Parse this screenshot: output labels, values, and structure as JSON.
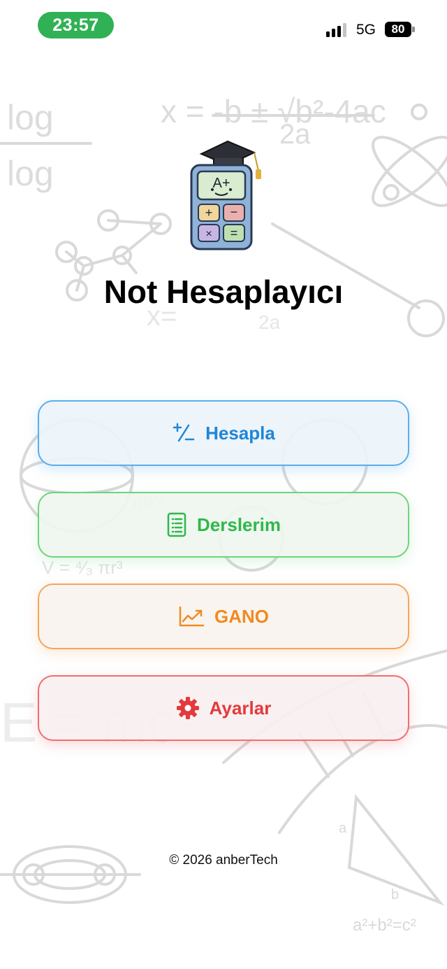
{
  "status_bar": {
    "time": "23:57",
    "network": "5G",
    "battery": "80"
  },
  "app": {
    "title": "Not Hesaplayıcı",
    "logo_text": "A+"
  },
  "menu": {
    "hesapla_label": "Hesapla",
    "derslerim_label": "Derslerim",
    "gano_label": "GANO",
    "ayarlar_label": "Ayarlar"
  },
  "footer": {
    "copyright": "© 2026 anberTech"
  },
  "icons": {
    "hesapla": "plus-minus-icon",
    "derslerim": "list-document-icon",
    "gano": "line-chart-icon",
    "ayarlar": "gear-icon"
  },
  "colors": {
    "status_time_bg": "#30b155",
    "hesapla": "#1f86d6",
    "derslerim": "#2fb84a",
    "gano": "#f08a21",
    "ayarlar": "#e23a3d"
  }
}
